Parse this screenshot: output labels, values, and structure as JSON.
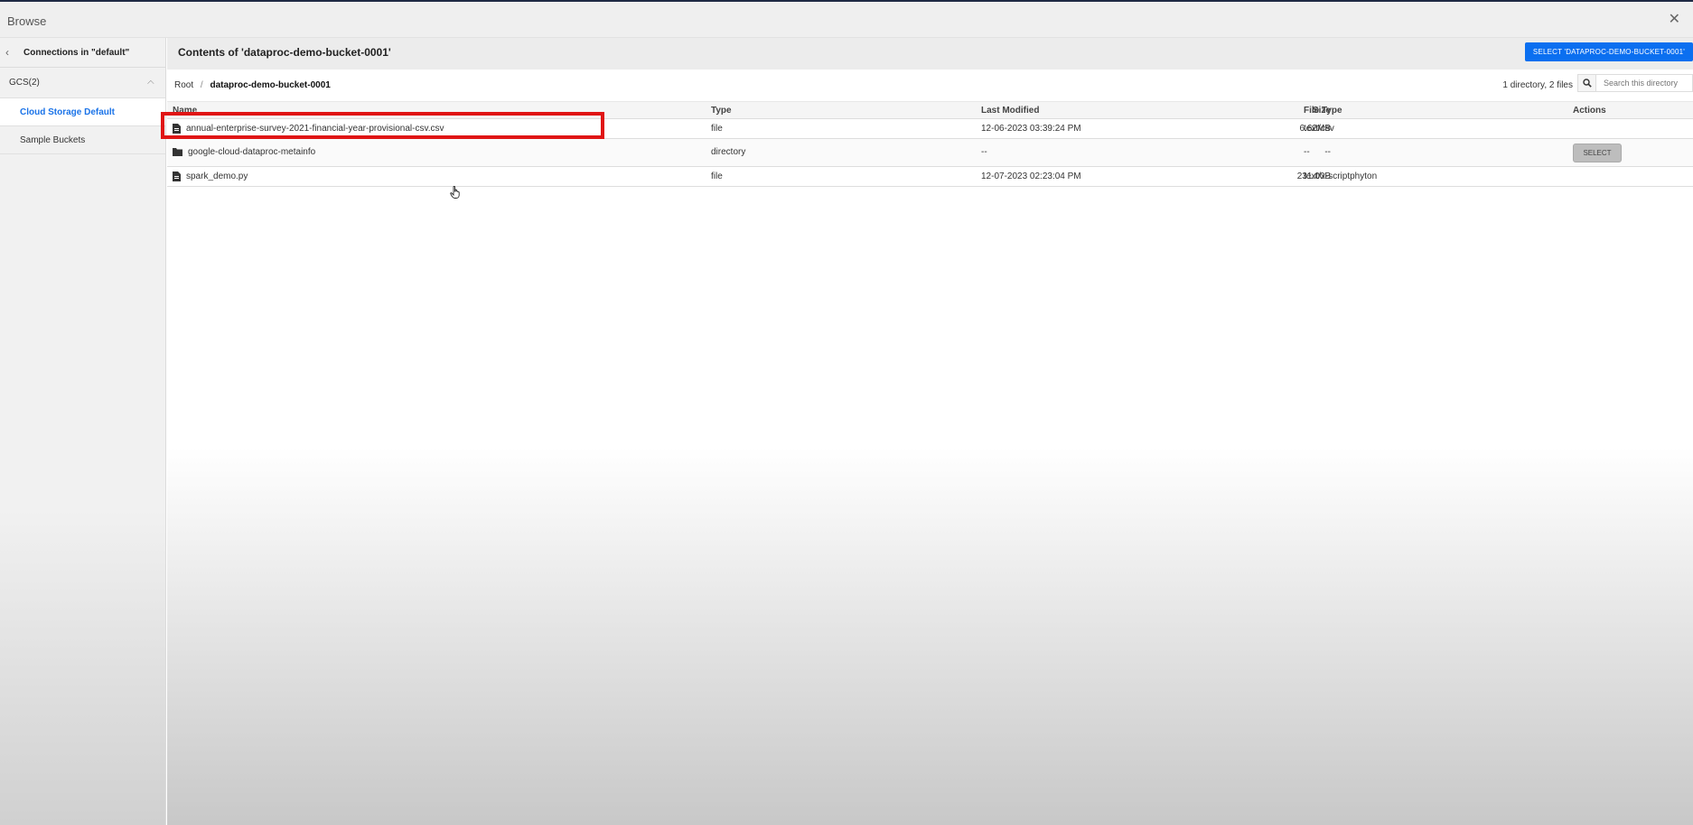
{
  "window": {
    "title": "Browse",
    "close_icon": "close-icon"
  },
  "sidebar": {
    "back_label": "Connections in \"default\"",
    "group": {
      "label": "GCS(2)",
      "expanded": true
    },
    "items": [
      {
        "label": "Cloud Storage Default",
        "active": true
      },
      {
        "label": "Sample Buckets",
        "active": false
      }
    ]
  },
  "main": {
    "heading": "Contents of 'dataproc-demo-bucket-0001'",
    "select_bucket_label": "SELECT 'DATAPROC-DEMO-BUCKET-0001'",
    "breadcrumb": {
      "root": "Root",
      "separator": "/",
      "current": "dataproc-demo-bucket-0001"
    },
    "counts": "1 directory, 2 files",
    "search": {
      "placeholder": "Search this directory",
      "value": ""
    },
    "columns": {
      "name": "Name",
      "type": "Type",
      "modified": "Last Modified",
      "size": "Size",
      "file_type": "File Type",
      "actions": "Actions"
    },
    "rows": [
      {
        "icon": "file-icon",
        "name": "annual-enterprise-survey-2021-financial-year-provisional-csv.csv",
        "type": "file",
        "modified": "12-06-2023 03:39:24 PM",
        "size": "6.62MB",
        "file_type": "text/csv",
        "action": ""
      },
      {
        "icon": "folder-icon",
        "name": "google-cloud-dataproc-metainfo",
        "type": "directory",
        "modified": "--",
        "size": "--",
        "file_type": "--",
        "action": "SELECT"
      },
      {
        "icon": "file-icon",
        "name": "spark_demo.py",
        "type": "file",
        "modified": "12-07-2023 02:23:04 PM",
        "size": "231.00B",
        "file_type": "text/x-scriptphyton",
        "action": ""
      }
    ]
  },
  "colors": {
    "accent": "#0b6ff0",
    "active_link": "#1a73e8",
    "highlight": "#e01515"
  }
}
